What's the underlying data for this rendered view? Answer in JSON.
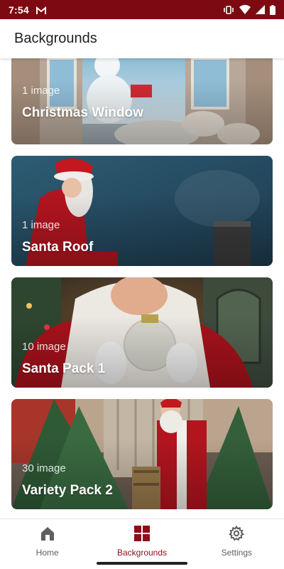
{
  "status_bar": {
    "time": "7:54",
    "icons": [
      "gmail-icon",
      "vibrate-icon",
      "wifi-icon",
      "signal-icon",
      "battery-icon"
    ]
  },
  "app_bar": {
    "title": "Backgrounds"
  },
  "backgrounds": [
    {
      "count": "1 image",
      "title": "Christmas Window"
    },
    {
      "count": "1 image",
      "title": "Santa Roof"
    },
    {
      "count": "10 image",
      "title": "Santa Pack 1"
    },
    {
      "count": "30 image",
      "title": "Variety Pack 2"
    }
  ],
  "bottom_nav": {
    "items": [
      {
        "label": "Home",
        "icon": "home-icon",
        "active": false
      },
      {
        "label": "Backgrounds",
        "icon": "grid-icon",
        "active": true
      },
      {
        "label": "Settings",
        "icon": "gear-icon",
        "active": false
      }
    ]
  },
  "colors": {
    "status_bar": "#7d0a12",
    "accent": "#8e0d19",
    "inactive": "#5f5f5f"
  }
}
